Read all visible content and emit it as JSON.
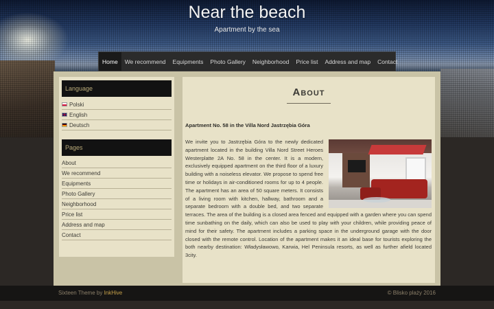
{
  "site": {
    "title": "Near the beach",
    "tagline": "Apartment by the sea"
  },
  "nav": {
    "items": [
      {
        "label": "Home",
        "active": true
      },
      {
        "label": "We recommend"
      },
      {
        "label": "Equipments"
      },
      {
        "label": "Photo Gallery"
      },
      {
        "label": "Neighborhood"
      },
      {
        "label": "Price list"
      },
      {
        "label": "Address and map"
      },
      {
        "label": "Contact"
      }
    ]
  },
  "sidebar": {
    "language": {
      "title": "Language",
      "items": [
        {
          "label": "Polski",
          "flag": "poland-flag-icon"
        },
        {
          "label": "English",
          "flag": "uk-flag-icon"
        },
        {
          "label": "Deutsch",
          "flag": "germany-flag-icon"
        }
      ]
    },
    "pages": {
      "title": "Pages",
      "items": [
        {
          "label": "About"
        },
        {
          "label": "We recommend"
        },
        {
          "label": "Equipments"
        },
        {
          "label": "Photo Gallery"
        },
        {
          "label": "Neighborhood"
        },
        {
          "label": "Price list"
        },
        {
          "label": "Address and map"
        },
        {
          "label": "Contact"
        }
      ]
    }
  },
  "content": {
    "title": "About",
    "subheading": "Apartment No. 58 in the Villa Nord Jastrzębia Góra",
    "body": "We invite you to Jastrzębia Góra to the newly dedicated apartment located in the building Villa Nord Street Heroes Westerplatte 2A No. 58 in the center. It is a modern, exclusively equipped apartment on the third floor of a luxury building with a noiseless elevator. We propose to spend free time or holidays in air-conditioned rooms for up to 4 people. The apartment has an area of 50 square meters. It consists of a living room with kitchen, hallway, bathroom and a separate bedroom with a double bed, and two separate terraces. The area of the building is a closed area fenced and equipped with a garden where you can spend time sunbathing on the daily, which can also be used to play with your children, while providing peace of mind for their safety. The apartment includes a parking space in the underground garage with the door closed with the remote control. Location of the apartment makes it an ideal base for tourists exploring the both nearby destination: Władysławowo, Karwia, Hel Peninsula resorts, as well as further afield located 3city."
  },
  "footer": {
    "theme_text": "Sixteen Theme by ",
    "theme_link": "InkHive",
    "copyright": "© Blisko plaży 2016"
  }
}
